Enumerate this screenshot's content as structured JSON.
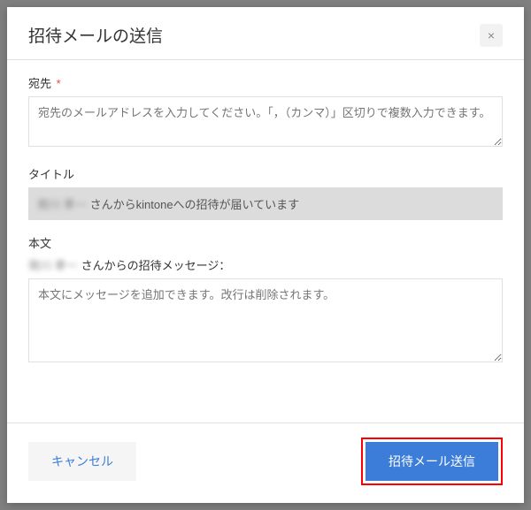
{
  "modal": {
    "title": "招待メールの送信",
    "close_label": "×"
  },
  "fields": {
    "to": {
      "label": "宛先",
      "required_marker": "*",
      "placeholder": "宛先のメールアドレスを入力してください。「，（カンマ）」区切りで複数入力できます。"
    },
    "title": {
      "label": "タイトル",
      "blurred_name": "発川 孝一",
      "fixed_suffix": "さんからkintoneへの招待が届いています"
    },
    "body": {
      "label": "本文",
      "blurred_name": "発川 孝一",
      "intro_suffix": "さんからの招待メッセージ：",
      "placeholder": "本文にメッセージを追加できます。改行は削除されます。"
    }
  },
  "buttons": {
    "cancel": "キャンセル",
    "send": "招待メール送信"
  }
}
